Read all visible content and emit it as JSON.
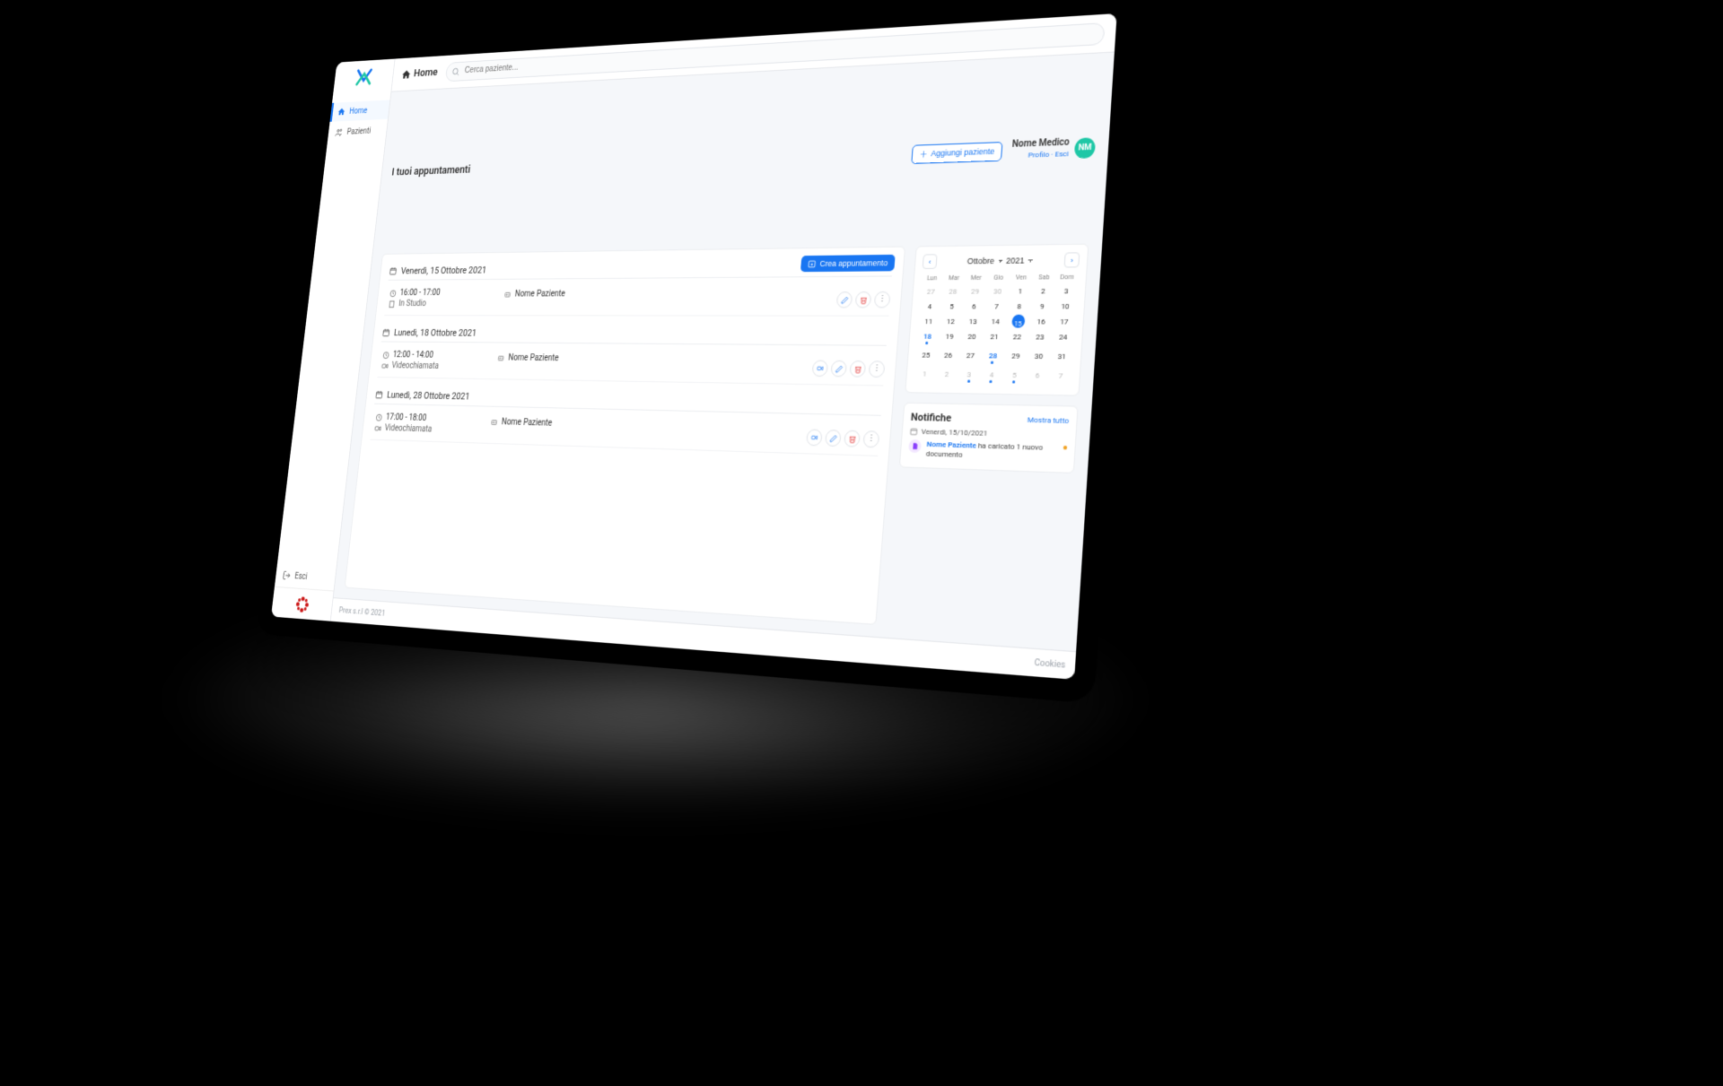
{
  "colors": {
    "primary": "#1976f2",
    "accent": "#1ec7a6",
    "danger": "#e03030",
    "warn": "#f0a020"
  },
  "topbar": {
    "breadcrumb": "Home",
    "search_placeholder": "Cerca paziente..."
  },
  "sidebar": {
    "items": [
      {
        "icon": "home",
        "label": "Home",
        "active": true
      },
      {
        "icon": "users",
        "label": "Pazienti",
        "active": false
      }
    ],
    "logout_label": "Esci"
  },
  "header": {
    "page_title": "I tuoi appuntamenti",
    "add_patient_label": "Aggiungi paziente",
    "user": {
      "name": "Nome Medico",
      "profile_link": "Profilo",
      "logout_link": "Esci",
      "initials": "NM"
    }
  },
  "appointments": {
    "create_label": "Crea appuntamento",
    "groups": [
      {
        "day_label": "Venerdì, 15 Ottobre 2021",
        "items": [
          {
            "time": "16:00 - 17:00",
            "mode": "In Studio",
            "mode_icon": "building",
            "patient": "Nome Paziente",
            "has_video": false
          }
        ]
      },
      {
        "day_label": "Lunedì, 18 Ottobre 2021",
        "items": [
          {
            "time": "12:00 - 14:00",
            "mode": "Videochiamata",
            "mode_icon": "video",
            "patient": "Nome Paziente",
            "has_video": true
          }
        ]
      },
      {
        "day_label": "Lunedì, 28 Ottobre 2021",
        "items": [
          {
            "time": "17:00 - 18:00",
            "mode": "Videochiamata",
            "mode_icon": "video",
            "patient": "Nome Paziente",
            "has_video": true
          }
        ]
      }
    ]
  },
  "calendar": {
    "month": "Ottobre",
    "year": "2021",
    "weekdays": [
      "Lun",
      "Mar",
      "Mer",
      "Gio",
      "Ven",
      "Sab",
      "Dom"
    ],
    "cells": [
      {
        "n": "27",
        "muted": true
      },
      {
        "n": "28",
        "muted": true
      },
      {
        "n": "29",
        "muted": true
      },
      {
        "n": "30",
        "muted": true
      },
      {
        "n": "1"
      },
      {
        "n": "2"
      },
      {
        "n": "3"
      },
      {
        "n": "4"
      },
      {
        "n": "5"
      },
      {
        "n": "6"
      },
      {
        "n": "7"
      },
      {
        "n": "8"
      },
      {
        "n": "9"
      },
      {
        "n": "10"
      },
      {
        "n": "11"
      },
      {
        "n": "12"
      },
      {
        "n": "13"
      },
      {
        "n": "14"
      },
      {
        "n": "15",
        "today": true,
        "dot": true
      },
      {
        "n": "16"
      },
      {
        "n": "17"
      },
      {
        "n": "18",
        "marked": true,
        "dot": true
      },
      {
        "n": "19"
      },
      {
        "n": "20"
      },
      {
        "n": "21"
      },
      {
        "n": "22"
      },
      {
        "n": "23"
      },
      {
        "n": "24"
      },
      {
        "n": "25"
      },
      {
        "n": "26"
      },
      {
        "n": "27"
      },
      {
        "n": "28",
        "marked": true,
        "dot": true
      },
      {
        "n": "29"
      },
      {
        "n": "30"
      },
      {
        "n": "31"
      },
      {
        "n": "1",
        "muted": true
      },
      {
        "n": "2",
        "muted": true
      },
      {
        "n": "3",
        "muted": true,
        "dot": true
      },
      {
        "n": "4",
        "muted": true,
        "dot": true
      },
      {
        "n": "5",
        "muted": true,
        "dot": true
      },
      {
        "n": "6",
        "muted": true
      },
      {
        "n": "7",
        "muted": true
      }
    ]
  },
  "notifications": {
    "title": "Notifiche",
    "show_all": "Mostra tutto",
    "date_label": "Venerdì, 15/10/2021",
    "item": {
      "patient": "Nome Paziente",
      "text": " ha caricato 1 nuovo documento"
    }
  },
  "footer": {
    "left": "Prex s.r.l © 2021",
    "right": "Cookies"
  }
}
